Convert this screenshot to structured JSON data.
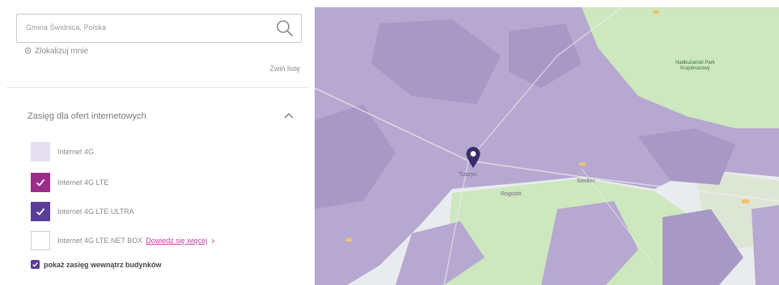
{
  "search": {
    "value": "Gmina Świdnica, Polska"
  },
  "locate_label": "Zlokalizuj mnie",
  "collapse_label": "Zwiń listę",
  "coverage_section": {
    "title": "Zasięg dla ofert internetowych",
    "items": [
      {
        "label": "Internet 4G",
        "checked": false,
        "color": "#e4e0f2"
      },
      {
        "label": "Internet 4G LTE",
        "checked": true,
        "color": "#9a2c8a"
      },
      {
        "label": "Internet 4G LTE ULTRA",
        "checked": true,
        "color": "#5a3c9a"
      },
      {
        "label": "Internet 4G LTE NET BOX",
        "checked": false,
        "color": "#ffffff",
        "link": "Dowiedz się więcej"
      }
    ]
  },
  "indoor_toggle": {
    "label": "pokaż zasięg wewnątrz budynków",
    "checked": true
  },
  "map": {
    "park_label": [
      "Nadbużański Park",
      "Krajobrazowy"
    ],
    "place_labels": [
      "Tuszyn",
      "Rogozin",
      "Siedlec"
    ],
    "colors": {
      "coverage": "#b6a8d0",
      "land": "#e9ecef",
      "forest": "#cde7be"
    }
  },
  "colors": {
    "accent": "#c13fa8",
    "marker": "#3a2c6b"
  }
}
